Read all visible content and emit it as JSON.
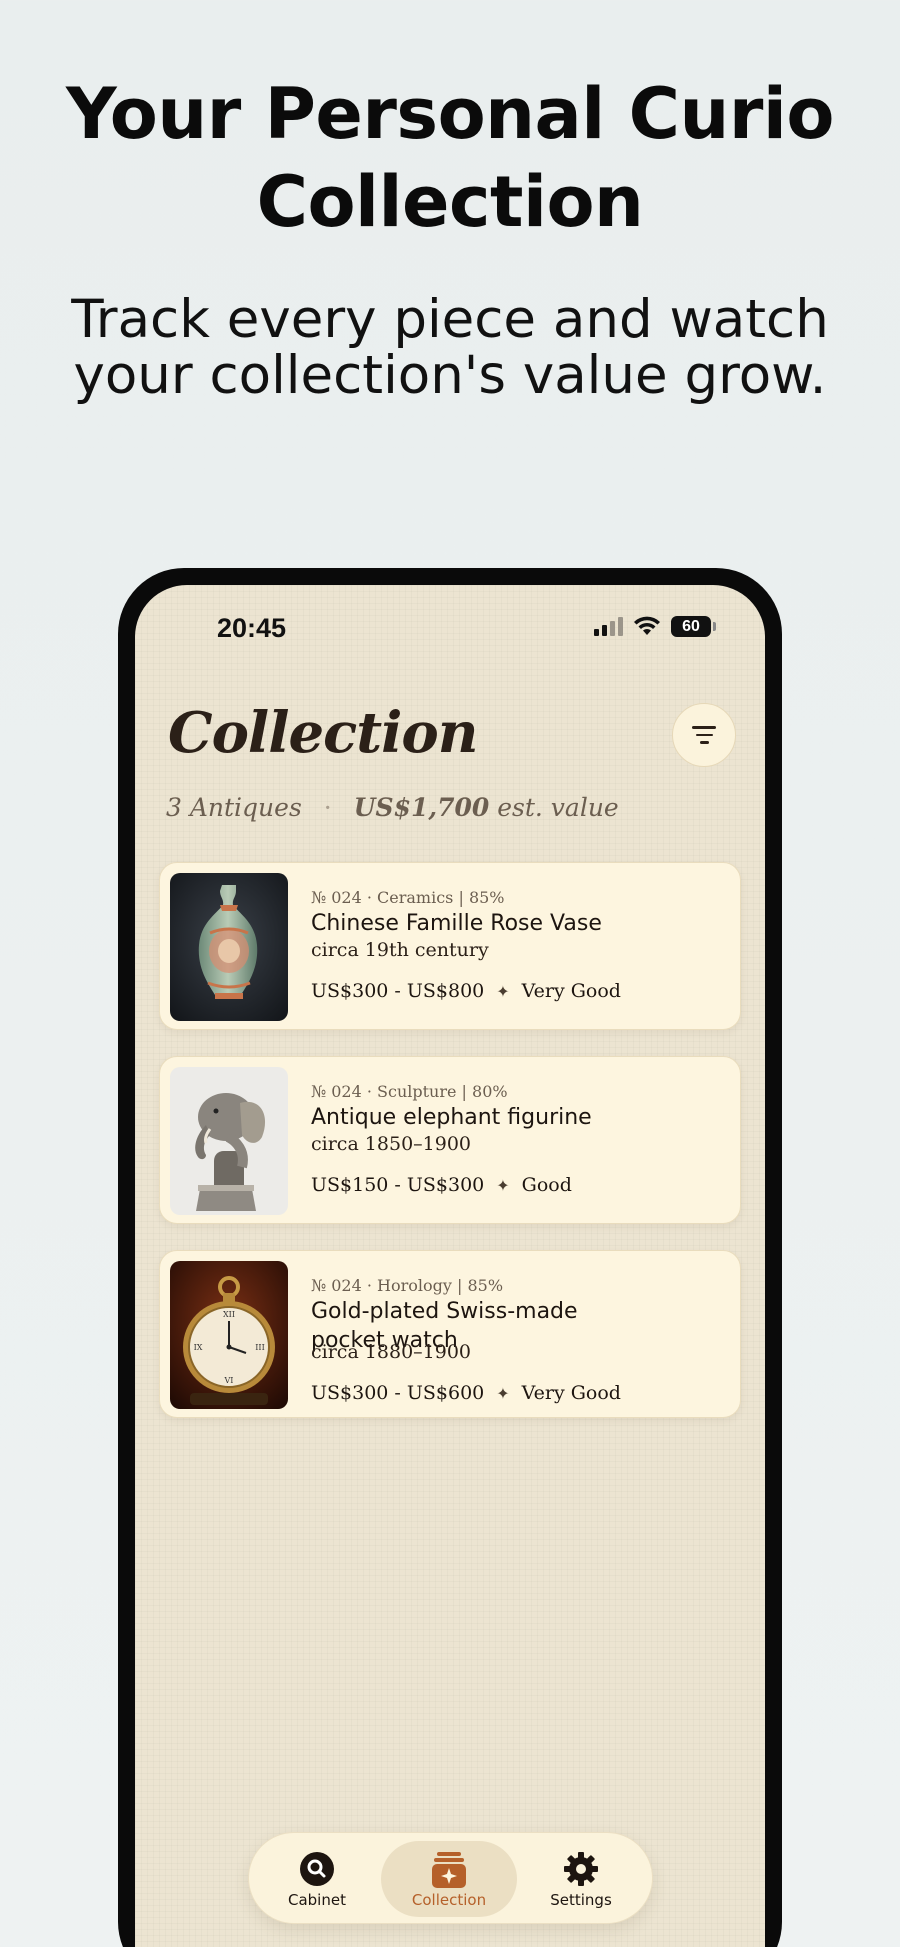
{
  "hero": {
    "title_line1": "Your Personal Curio",
    "title_line2": "Collection",
    "subtitle_line1": "Track every piece and watch",
    "subtitle_line2": "your collection's value grow."
  },
  "status_bar": {
    "time": "20:45",
    "battery": "60"
  },
  "header": {
    "title": "Collection",
    "filter_icon": "filter-lines-icon",
    "count": "3 Antiques",
    "value": "US$1,700",
    "value_suffix": "est. value"
  },
  "items": [
    {
      "meta": "№ 024 · Ceramics | 85%",
      "title": "Chinese Famille Rose Vase",
      "date": "circa 19th century",
      "price": "US$300 - US$800",
      "condition": "Very Good",
      "image": "vase-photo"
    },
    {
      "meta": "№ 024 · Sculpture | 80%",
      "title": "Antique elephant figurine",
      "date": "circa 1850–1900",
      "price": "US$150 - US$300",
      "condition": "Good",
      "image": "elephant-photo"
    },
    {
      "meta": "№ 024 · Horology | 85%",
      "title_line1": "Gold-plated Swiss-made",
      "title_line2": "pocket watch",
      "date": "circa 1880–1900",
      "price": "US$300 - US$600",
      "condition": "Very Good",
      "image": "pocket-watch-photo"
    }
  ],
  "tabs": [
    {
      "label": "Cabinet",
      "icon": "search-icon"
    },
    {
      "label": "Collection",
      "icon": "collection-sparkle-icon",
      "active": true
    },
    {
      "label": "Settings",
      "icon": "gear-icon"
    }
  ],
  "colors": {
    "accent": "#b5602a",
    "card": "#fdf5df",
    "screen": "#ece4d1"
  }
}
